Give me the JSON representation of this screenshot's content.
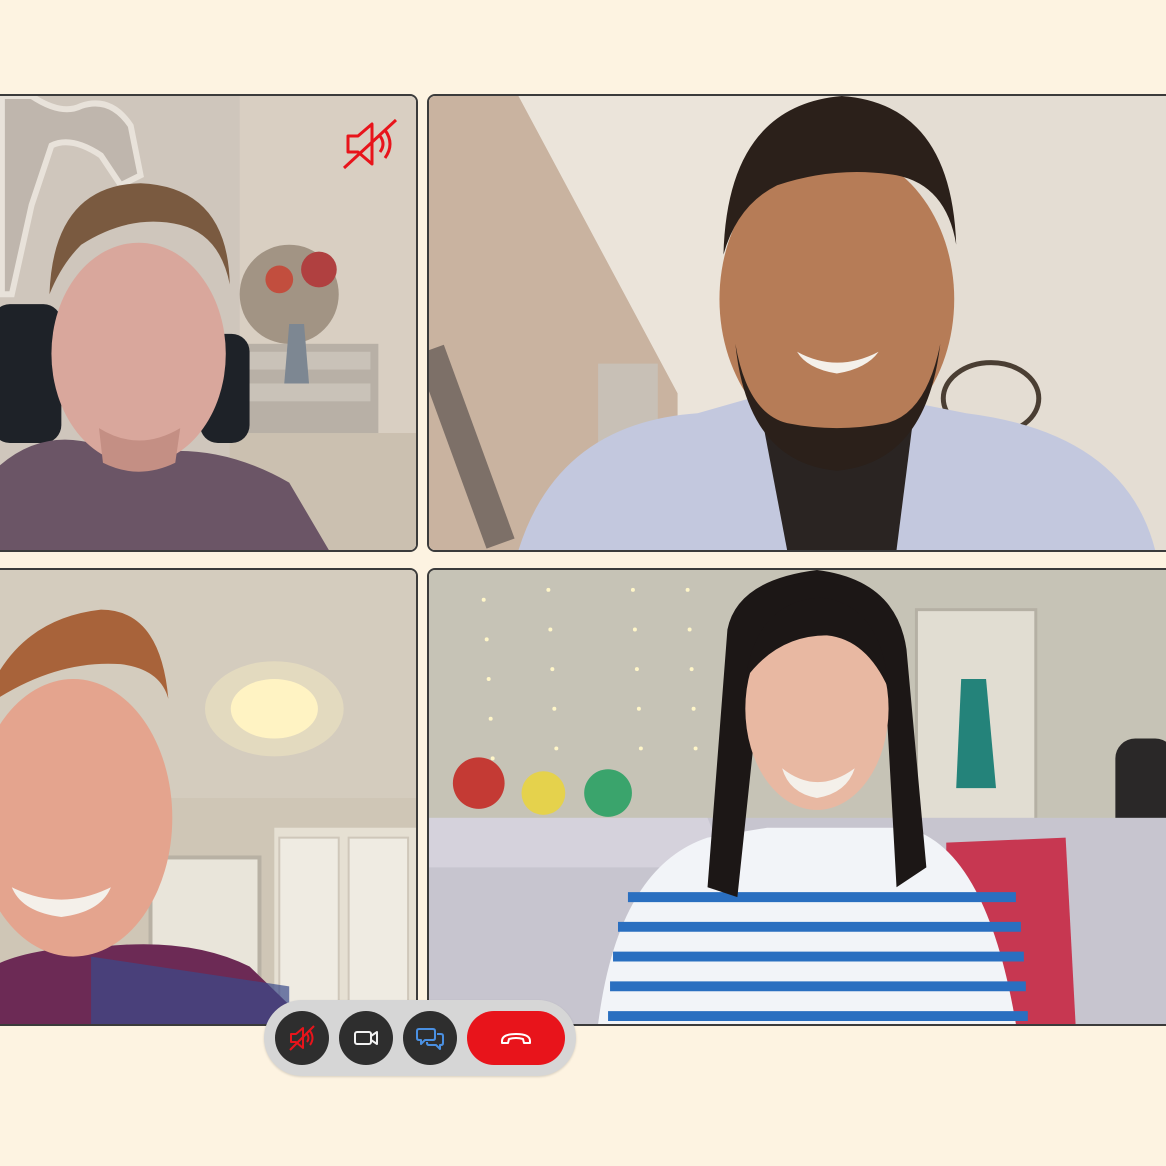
{
  "call": {
    "participants": [
      {
        "id": "p1",
        "muted": true,
        "mute_icon": "speaker-muted-icon"
      },
      {
        "id": "p2",
        "muted": false
      },
      {
        "id": "p3",
        "muted": false
      },
      {
        "id": "p4",
        "muted": false
      }
    ]
  },
  "controls": {
    "mute": {
      "icon": "speaker-muted-icon"
    },
    "video": {
      "icon": "video-camera-icon"
    },
    "chat": {
      "icon": "chat-bubbles-icon"
    },
    "hangup": {
      "icon": "hang-up-icon"
    }
  },
  "colors": {
    "background": "#fdf3e1",
    "tile_border": "#3b3b3b",
    "control_bar": "#d6d6d6",
    "control_button": "#2e2e2e",
    "hangup": "#e8141b",
    "mute_red": "#e8141b",
    "chat_blue": "#4a90e2"
  }
}
